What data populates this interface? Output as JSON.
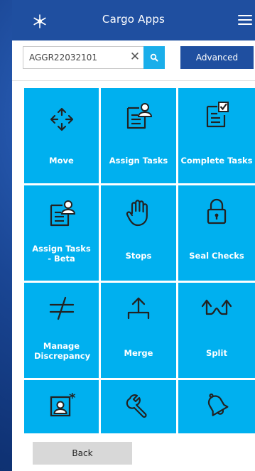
{
  "header": {
    "title": "Cargo Apps",
    "logo_icon": "snowflake-logo-icon",
    "menu_icon": "hamburger-menu-icon"
  },
  "search": {
    "value": "AGGR22032101",
    "clear_icon": "close-icon",
    "search_icon": "search-icon",
    "advanced_label": "Advanced"
  },
  "tiles": [
    {
      "label": "Move",
      "icon": "move-arrows-icon"
    },
    {
      "label": "Assign Tasks",
      "icon": "assign-tasks-icon"
    },
    {
      "label": "Complete Tasks",
      "icon": "complete-tasks-icon"
    },
    {
      "label": "Assign Tasks - Beta",
      "icon": "assign-tasks-beta-icon"
    },
    {
      "label": "Stops",
      "icon": "hand-stop-icon"
    },
    {
      "label": "Seal Checks",
      "icon": "padlock-icon"
    },
    {
      "label": "Manage Discrepancy",
      "icon": "not-equal-icon"
    },
    {
      "label": "Merge",
      "icon": "merge-arrow-icon"
    },
    {
      "label": "Split",
      "icon": "split-arrows-icon"
    },
    {
      "label": "",
      "icon": "profile-star-icon"
    },
    {
      "label": "",
      "icon": "wrench-icon"
    },
    {
      "label": "",
      "icon": "bell-icon"
    }
  ],
  "footer": {
    "back_label": "Back"
  },
  "colors": {
    "header": "#1f4fa0",
    "tile": "#00b0ef",
    "search_button": "#1aaeea",
    "back_button": "#d8d8d8"
  }
}
